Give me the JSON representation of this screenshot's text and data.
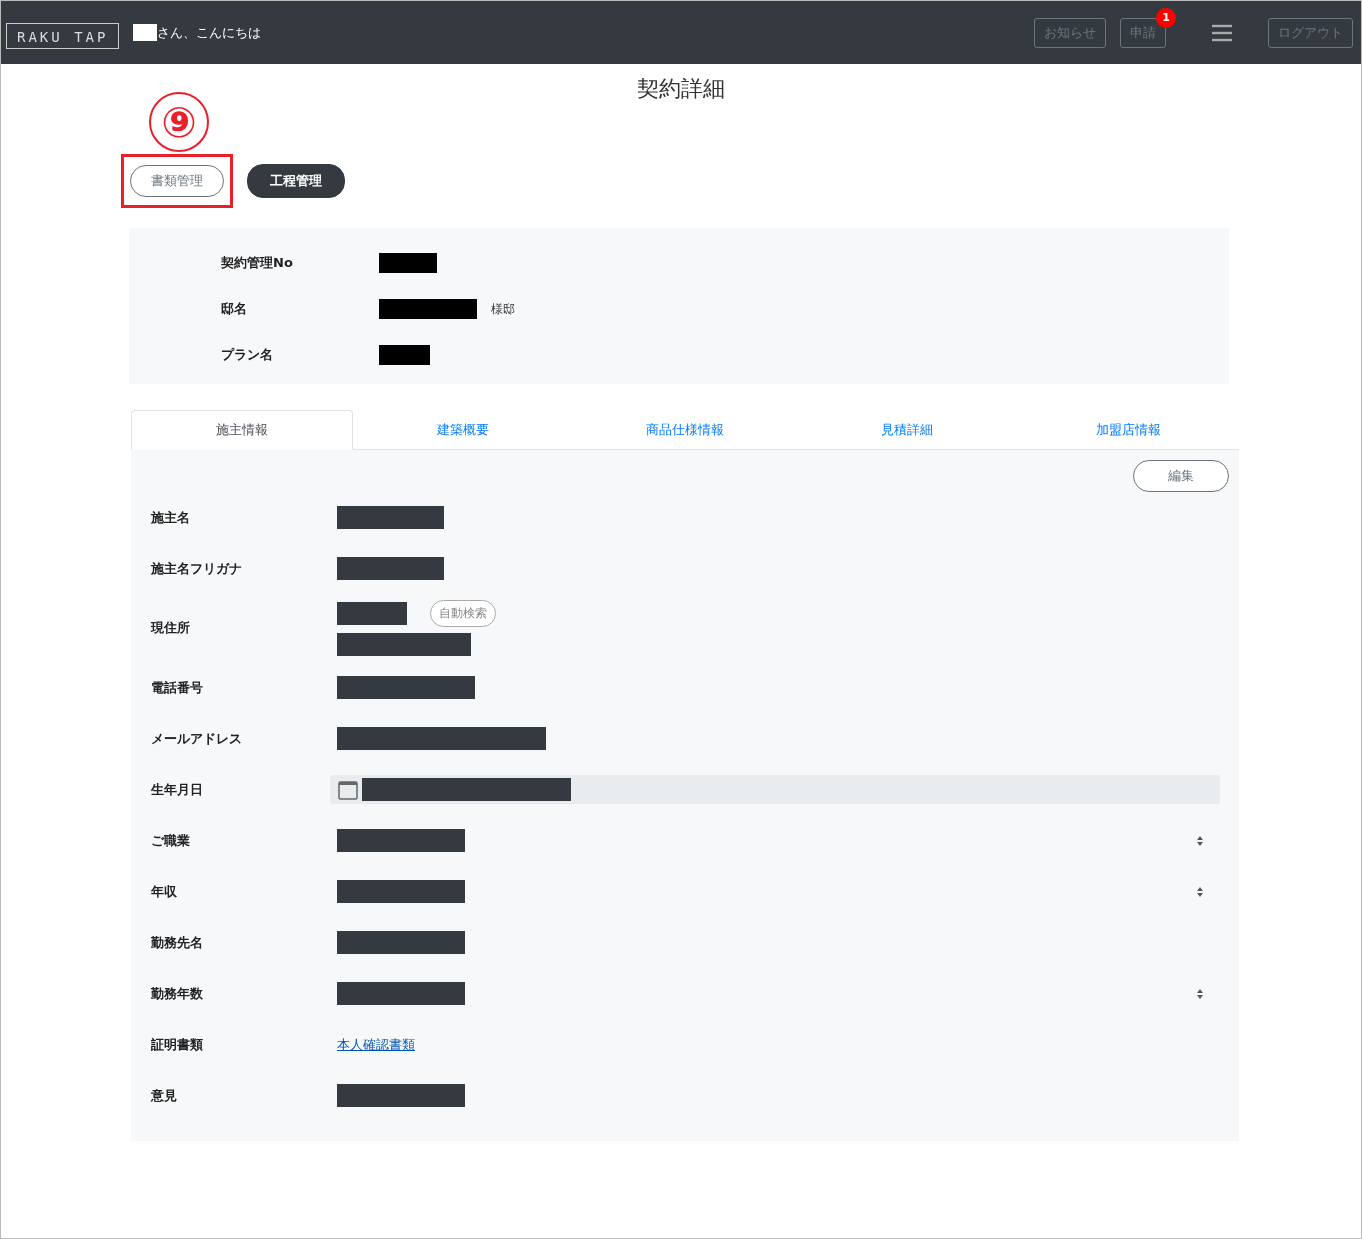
{
  "header": {
    "logo": "RAKU TAP",
    "greeting": "さん、こんにちは",
    "buttons": [
      {
        "label": "お知らせ"
      },
      {
        "label": "申請",
        "badge": "1"
      }
    ],
    "logout": "ログアウト"
  },
  "title": "契約詳細",
  "annotation": {
    "number": "⑨"
  },
  "action_buttons": [
    {
      "label": "書類管理",
      "selected": false,
      "highlighted": true
    },
    {
      "label": "工程管理",
      "selected": true,
      "highlighted": false
    }
  ],
  "summary": [
    {
      "label": "契約管理No"
    },
    {
      "label": "邸名",
      "suffix": "様邸"
    },
    {
      "label": "プラン名"
    }
  ],
  "tabs": [
    {
      "label": "施主情報",
      "selected": true
    },
    {
      "label": "建築概要",
      "selected": false
    },
    {
      "label": "商品仕様情報",
      "selected": false
    },
    {
      "label": "見積詳細",
      "selected": false
    },
    {
      "label": "加盟店情報",
      "selected": false
    }
  ],
  "edit_button": "編集",
  "fields": [
    {
      "label": "施主名",
      "kind": "text"
    },
    {
      "label": "施主名フリガナ",
      "kind": "text"
    },
    {
      "label": "現住所",
      "kind": "address",
      "button": "自動検索"
    },
    {
      "label": "電話番号",
      "kind": "text"
    },
    {
      "label": "メールアドレス",
      "kind": "text"
    },
    {
      "label": "生年月日",
      "kind": "date"
    },
    {
      "label": "ご職業",
      "kind": "select"
    },
    {
      "label": "年収",
      "kind": "select"
    },
    {
      "label": "勤務先名",
      "kind": "text"
    },
    {
      "label": "勤務年数",
      "kind": "select"
    },
    {
      "label": "証明書類",
      "kind": "link",
      "link": "本人確認書類"
    },
    {
      "label": "意見",
      "kind": "text"
    }
  ]
}
